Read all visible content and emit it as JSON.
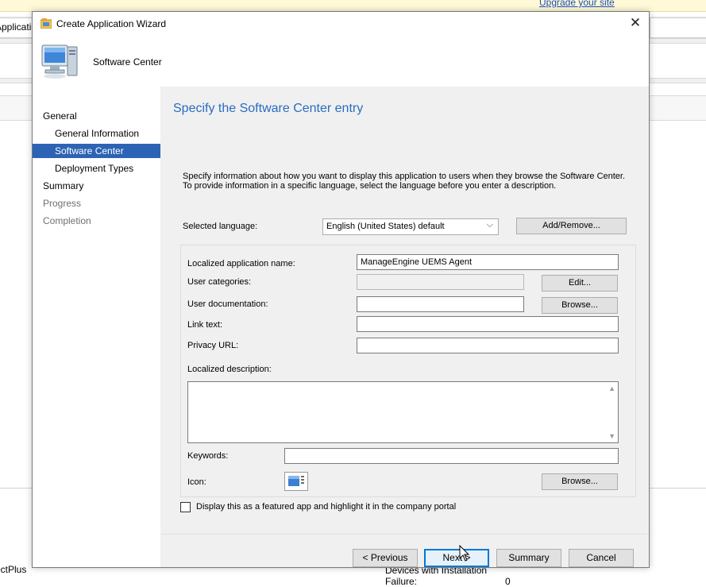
{
  "background": {
    "upgrade_link": "Upgrade your site",
    "tab_left_label": "Applicatio",
    "left_footer_text": "ectPlus",
    "devices_label": "Devices with Installation",
    "failure_label": "Failure:",
    "failure_value": "0"
  },
  "dialog": {
    "title": "Create Application Wizard",
    "close_glyph": "✕",
    "header_title": "Software Center"
  },
  "nav": {
    "items": [
      {
        "label": "General",
        "level": 1,
        "state": "normal"
      },
      {
        "label": "General Information",
        "level": 2,
        "state": "normal"
      },
      {
        "label": "Software Center",
        "level": 2,
        "state": "selected"
      },
      {
        "label": "Deployment Types",
        "level": 2,
        "state": "normal"
      },
      {
        "label": "Summary",
        "level": 1,
        "state": "normal"
      },
      {
        "label": "Progress",
        "level": 1,
        "state": "disabled"
      },
      {
        "label": "Completion",
        "level": 1,
        "state": "disabled"
      }
    ]
  },
  "content": {
    "heading": "Specify the Software Center entry",
    "description": "Specify information about how you want to display this application to users when they browse the Software Center. To provide information in a specific language, select the language before you enter a description.",
    "selected_language_label": "Selected language:",
    "selected_language_value": "English (United States) default",
    "add_remove_button": "Add/Remove...",
    "localized_name_label": "Localized application name:",
    "localized_name_value": "ManageEngine UEMS Agent",
    "user_categories_label": "User categories:",
    "user_categories_value": "",
    "edit_button": "Edit...",
    "user_documentation_label": "User documentation:",
    "user_documentation_value": "",
    "browse_doc_button": "Browse...",
    "link_text_label": "Link text:",
    "link_text_value": "",
    "privacy_url_label": "Privacy URL:",
    "privacy_url_value": "",
    "localized_description_label": "Localized description:",
    "localized_description_value": "",
    "keywords_label": "Keywords:",
    "keywords_value": "",
    "icon_label": "Icon:",
    "browse_icon_button": "Browse...",
    "featured_checkbox_label": "Display this as a featured app and highlight it in the company portal",
    "featured_checked": false
  },
  "footer": {
    "previous_button": "< Previous",
    "next_button": "Next >",
    "summary_button": "Summary",
    "cancel_button": "Cancel"
  },
  "icons": [
    "wizard-app-icon",
    "close-icon",
    "computer-icon",
    "chevron-down-icon",
    "app-icon-preview",
    "mouse-pointer-icon"
  ]
}
